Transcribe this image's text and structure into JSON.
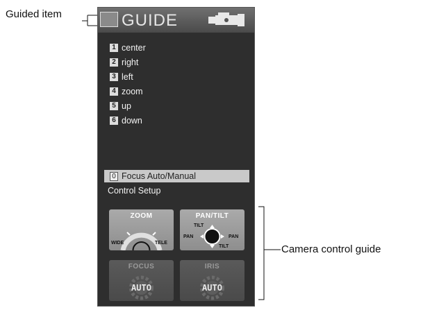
{
  "callouts": {
    "guided_item": "Guided item",
    "camera_control_guide": "Camera control guide"
  },
  "panel": {
    "title": "GUIDE",
    "menu": [
      {
        "num": "1",
        "label": "center"
      },
      {
        "num": "2",
        "label": "right"
      },
      {
        "num": "3",
        "label": "left"
      },
      {
        "num": "4",
        "label": "zoom"
      },
      {
        "num": "5",
        "label": "up"
      },
      {
        "num": "6",
        "label": "down"
      }
    ],
    "focus_item": {
      "num": "0",
      "label": "Focus Auto/Manual"
    },
    "control_setup": "Control Setup"
  },
  "controls": {
    "zoom": {
      "title": "ZOOM",
      "wide": "WIDE",
      "tele": "TELE"
    },
    "pantilt": {
      "title": "PAN/TILT",
      "tilt_top": "TILT",
      "tilt_bottom": "TILT",
      "pan_left": "PAN",
      "pan_right": "PAN"
    },
    "focus": {
      "title": "FOCUS",
      "mode": "AUTO"
    },
    "iris": {
      "title": "IRIS",
      "mode": "AUTO"
    }
  },
  "icons": [
    "camera-icon",
    "zoom-dial-icon",
    "joystick-icon",
    "focus-gear-icon",
    "iris-gear-icon"
  ]
}
